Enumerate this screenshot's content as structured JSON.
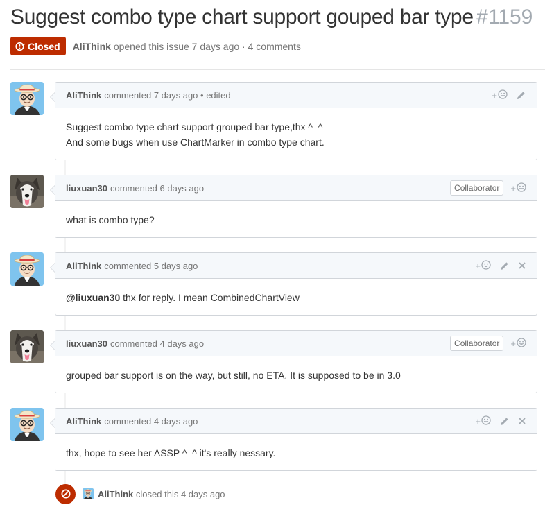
{
  "issue": {
    "title": "Suggest combo type chart support gouped bar type",
    "number": "#1159",
    "state_label": "Closed",
    "author": "AliThink",
    "meta_text": "opened this issue 7 days ago · 4 comments"
  },
  "colors": {
    "closed": "#bd2c00",
    "header_bg": "#f5f8fb",
    "border": "#d1d5da",
    "muted": "#767676"
  },
  "comments": [
    {
      "author": "AliThink",
      "meta": "commented 7 days ago • edited",
      "avatar": "cartoon-avatar",
      "badge": "",
      "actions": [
        "reaction-icon",
        "pencil-icon"
      ],
      "body_lines": [
        "Suggest combo type chart support grouped bar type,thx ^_^",
        "And some bugs when use ChartMarker in combo type chart."
      ]
    },
    {
      "author": "liuxuan30",
      "meta": "commented 6 days ago",
      "avatar": "dog-avatar",
      "badge": "Collaborator",
      "actions": [
        "reaction-icon"
      ],
      "body_lines": [
        "what is combo type?"
      ]
    },
    {
      "author": "AliThink",
      "meta": "commented 5 days ago",
      "avatar": "cartoon-avatar",
      "badge": "",
      "actions": [
        "reaction-icon",
        "pencil-icon",
        "close-icon"
      ],
      "mention": "@liuxuan30",
      "body_lines": [
        " thx for reply. I mean CombinedChartView"
      ]
    },
    {
      "author": "liuxuan30",
      "meta": "commented 4 days ago",
      "avatar": "dog-avatar",
      "badge": "Collaborator",
      "actions": [
        "reaction-icon"
      ],
      "body_lines": [
        "grouped bar support is on the way, but still, no ETA. It is supposed to be in 3.0"
      ]
    },
    {
      "author": "AliThink",
      "meta": "commented 4 days ago",
      "avatar": "cartoon-avatar",
      "badge": "",
      "actions": [
        "reaction-icon",
        "pencil-icon",
        "close-icon"
      ],
      "body_lines": [
        "thx, hope to see her ASSP ^_^ it's really nessary."
      ]
    }
  ],
  "event": {
    "author": "AliThink",
    "text": "closed this 4 days ago",
    "icon": "circle-slash-icon"
  },
  "reaction_plus": "+"
}
